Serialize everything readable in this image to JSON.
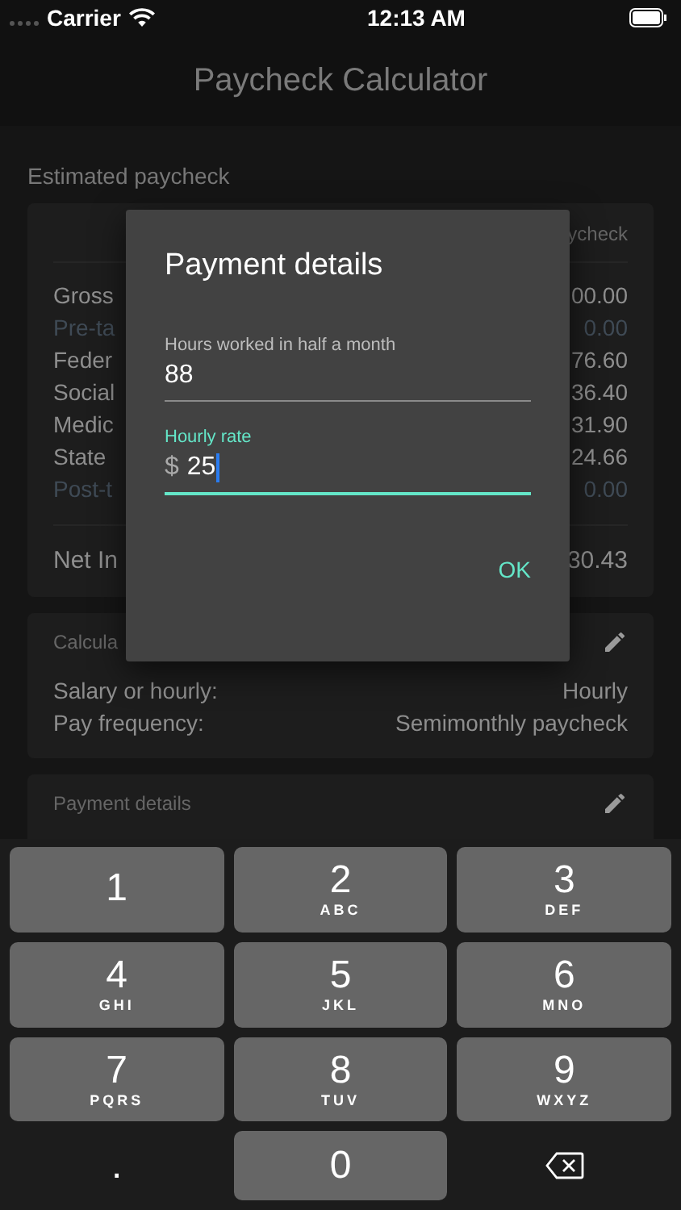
{
  "status_bar": {
    "carrier": "Carrier",
    "time": "12:13 AM"
  },
  "nav": {
    "title": "Paycheck Calculator"
  },
  "section_title": "Estimated paycheck",
  "summary": {
    "header_right": "ycheck",
    "rows": [
      {
        "label": "Gross",
        "value": "00.00",
        "dim": false
      },
      {
        "label": "Pre-ta",
        "value": "0.00",
        "dim": true
      },
      {
        "label": "Feder",
        "value": "76.60",
        "dim": false
      },
      {
        "label": "Social",
        "value": "36.40",
        "dim": false
      },
      {
        "label": "Medic",
        "value": "31.90",
        "dim": false
      },
      {
        "label": "State",
        "value": "24.66",
        "dim": false
      },
      {
        "label": "Post-t",
        "value": "0.00",
        "dim": true
      }
    ],
    "total": {
      "label": "Net In",
      "value": "30.43"
    }
  },
  "calc_card": {
    "title": "Calcula",
    "rows": [
      {
        "label": "Salary or hourly:",
        "value": "Hourly"
      },
      {
        "label": "Pay frequency:",
        "value": "Semimonthly paycheck"
      }
    ]
  },
  "payment_card": {
    "title": "Payment details"
  },
  "dialog": {
    "title": "Payment details",
    "fields": [
      {
        "label": "Hours worked in half a month",
        "value": "88",
        "focused": false
      },
      {
        "label": "Hourly rate",
        "prefix": "$",
        "value": "25",
        "focused": true
      }
    ],
    "button": "OK"
  },
  "keypad": [
    {
      "kind": "digit",
      "digit": "1"
    },
    {
      "kind": "digit",
      "digit": "2",
      "letters": "ABC"
    },
    {
      "kind": "digit",
      "digit": "3",
      "letters": "DEF"
    },
    {
      "kind": "digit",
      "digit": "4",
      "letters": "GHI"
    },
    {
      "kind": "digit",
      "digit": "5",
      "letters": "JKL"
    },
    {
      "kind": "digit",
      "digit": "6",
      "letters": "MNO"
    },
    {
      "kind": "digit",
      "digit": "7",
      "letters": "PQRS"
    },
    {
      "kind": "digit",
      "digit": "8",
      "letters": "TUV"
    },
    {
      "kind": "digit",
      "digit": "9",
      "letters": "WXYZ"
    },
    {
      "kind": "dot",
      "digit": "."
    },
    {
      "kind": "digit",
      "digit": "0"
    },
    {
      "kind": "delete"
    }
  ]
}
